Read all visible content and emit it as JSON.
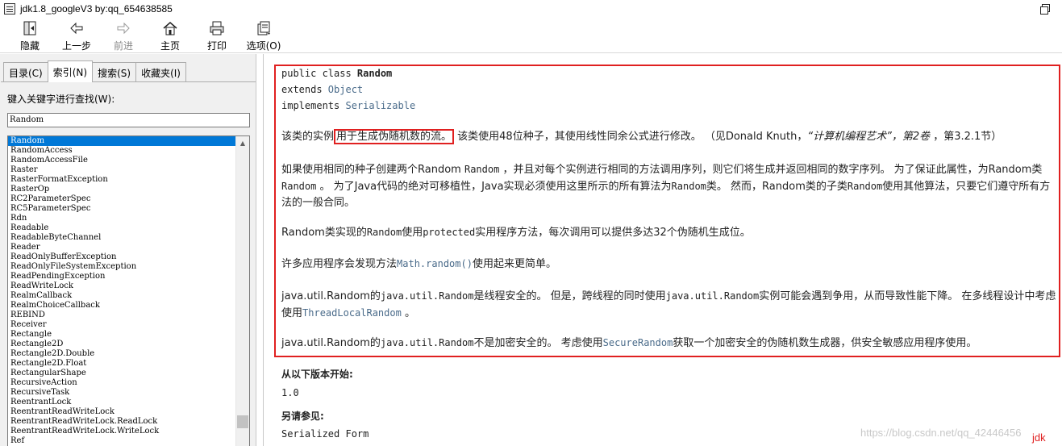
{
  "window": {
    "title": "jdk1.8_googleV3 by:qq_654638585"
  },
  "toolbar": {
    "buttons": [
      {
        "label": "隐藏",
        "icon": "hide-icon"
      },
      {
        "label": "上一步",
        "icon": "back-arrow-icon"
      },
      {
        "label": "前进",
        "icon": "forward-arrow-icon",
        "disabled": true
      },
      {
        "label": "主页",
        "icon": "home-icon"
      },
      {
        "label": "打印",
        "icon": "print-icon"
      },
      {
        "label": "选项(O)",
        "icon": "options-icon"
      }
    ]
  },
  "left": {
    "tabs": [
      "目录(C)",
      "索引(N)",
      "搜索(S)",
      "收藏夹(I)"
    ],
    "active_tab": "索引(N)",
    "search_label": "键入关键字进行查找(W):",
    "search_value": "Random",
    "list_items": [
      "Random",
      "RandomAccess",
      "RandomAccessFile",
      "Raster",
      "RasterFormatException",
      "RasterOp",
      "RC2ParameterSpec",
      "RC5ParameterSpec",
      "Rdn",
      "Readable",
      "ReadableByteChannel",
      "Reader",
      "ReadOnlyBufferException",
      "ReadOnlyFileSystemException",
      "ReadPendingException",
      "ReadWriteLock",
      "RealmCallback",
      "RealmChoiceCallback",
      "REBIND",
      "Receiver",
      "Rectangle",
      "Rectangle2D",
      "Rectangle2D.Double",
      "Rectangle2D.Float",
      "RectangularShape",
      "RecursiveAction",
      "RecursiveTask",
      "ReentrantLock",
      "ReentrantReadWriteLock",
      "ReentrantReadWriteLock.ReadLock",
      "ReentrantReadWriteLock.WriteLock",
      "Ref"
    ],
    "selected_item": "Random"
  },
  "doc": {
    "decl_line1_kw": "public class ",
    "decl_line1_name": "Random",
    "decl_line2_kw": "extends ",
    "decl_line2_link": "Object",
    "decl_line3_kw": "implements ",
    "decl_line3_link": "Serializable",
    "p1_a": "该类的实例",
    "p1_highlight": "用于生成伪随机数的流。",
    "p1_b": " 该类使用48位种子，其使用线性同余公式进行修改。 （见Donald Knuth，",
    "p1_italic": "“计算机编程艺术”，第2卷",
    "p1_c": " ，第3.2.1节）",
    "p2_a": "如果使用相同的种子创建两个Random ",
    "p2_code1": "Random",
    "p2_b": " ，并且对每个实例进行相同的方法调用序列，则它们将生成并返回相同的数字序列。 为了保证此属性，为Random类",
    "p2_code2": "Random",
    "p2_c": " 。 为了Java代码的绝对可移植性，Java实现必须使用这里所示的所有算法为",
    "p2_code3": "Random",
    "p2_d": "类。 然而，Random类的子类",
    "p2_code4": "Random",
    "p2_e": "使用其他算法，只要它们遵守所有方法的一般合同。",
    "p3_a": "Random类实现的",
    "p3_code1": "Random",
    "p3_b": "使用",
    "p3_code2": "protected",
    "p3_c": "实用程序方法，每次调用可以提供多达32个伪随机生成位。",
    "p4_a": "许多应用程序会发现方法",
    "p4_link": "Math.random()",
    "p4_b": "使用起来更简单。",
    "p5_a": "java.util.Random的",
    "p5_code1": "java.util.Random",
    "p5_b": "是线程安全的。 但是，跨线程的同时使用",
    "p5_code2": "java.util.Random",
    "p5_c": "实例可能会遇到争用，从而导致性能下降。 在多线程设计中考虑使用",
    "p5_link": "ThreadLocalRandom",
    "p5_d": " 。",
    "p6_a": "java.util.Random的",
    "p6_code1": "java.util.Random",
    "p6_b": "不是加密安全的。 考虑使用",
    "p6_link": "SecureRandom",
    "p6_c": "获取一个加密安全的伪随机数生成器，供安全敏感应用程序使用。",
    "since_label": "从以下版本开始:",
    "since_value": "1.0",
    "see_also_label": "另请参见:",
    "see_also_link": "Serialized Form"
  },
  "watermark": "https://blog.csdn.net/qq_42446456",
  "annotation_tag": "jdk",
  "colors": {
    "highlight_red": "#e02020",
    "link_blue": "#4a6b8a",
    "selection_blue": "#0078d7"
  }
}
